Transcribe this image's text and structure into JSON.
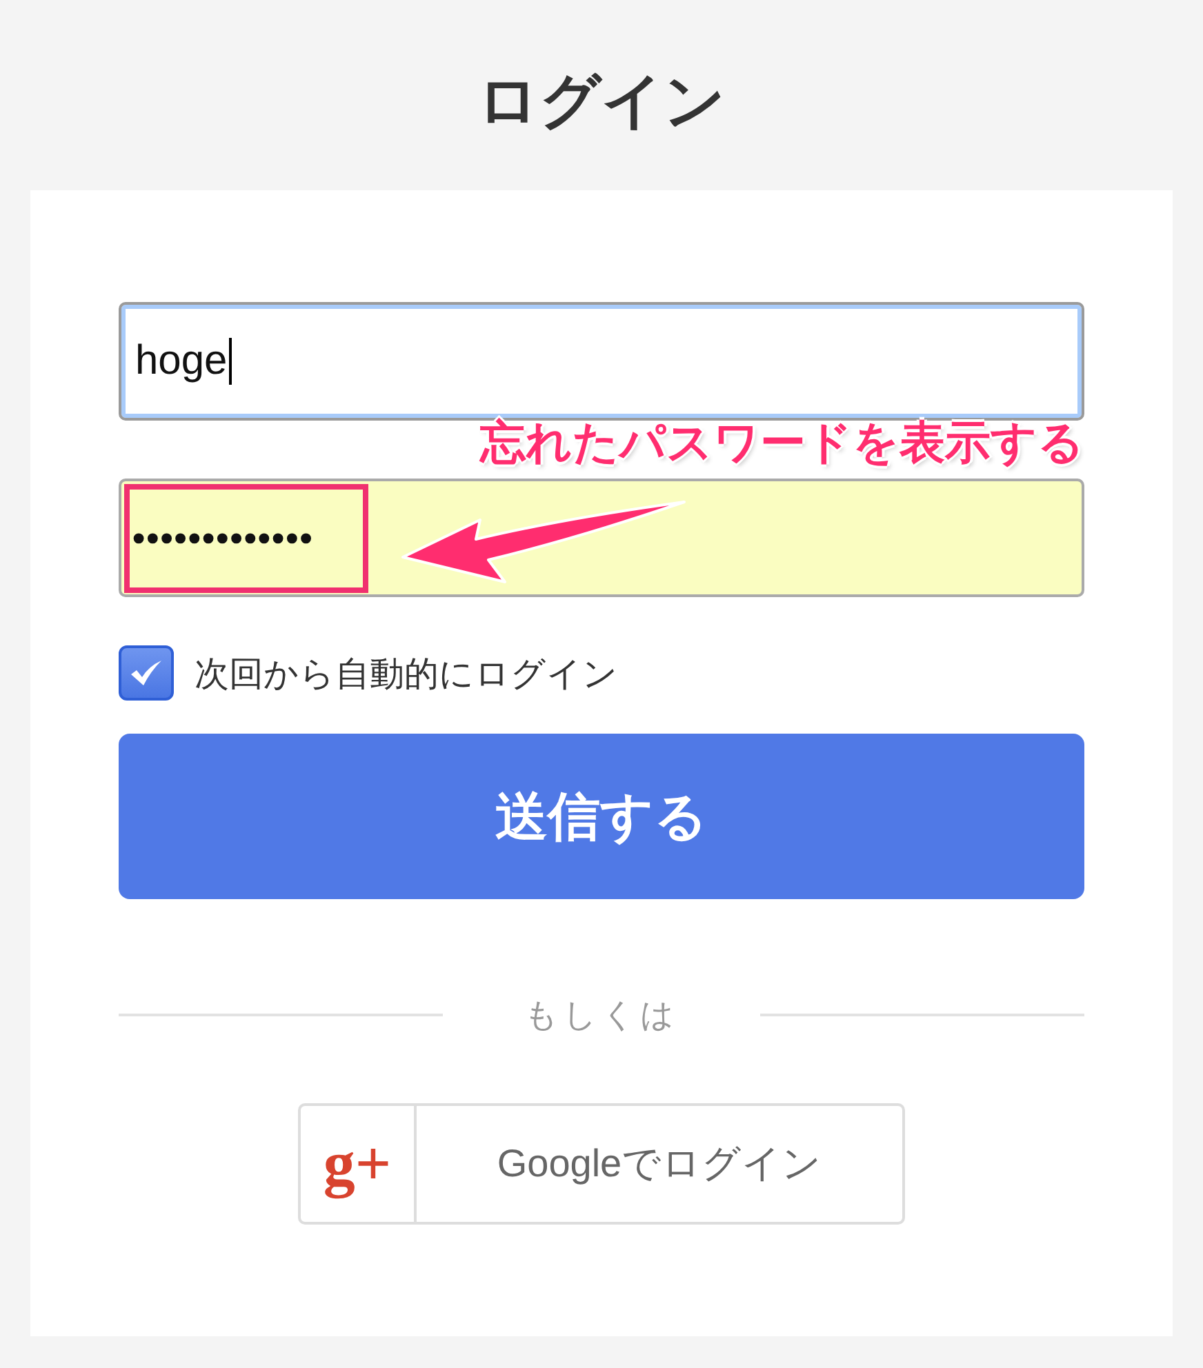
{
  "title": "ログイン",
  "form": {
    "username": {
      "value": "hoge",
      "focused": true
    },
    "password": {
      "value": "•••••••••••••",
      "autofilled": true
    },
    "remember": {
      "label": "次回から自動的にログイン",
      "checked": true
    },
    "submit": {
      "label": "送信する"
    },
    "separator": "もしくは",
    "social_button": {
      "icon": "g+",
      "label": "Googleでログイン"
    }
  },
  "annotation": {
    "text": "忘れたパスワードを表示する"
  }
}
